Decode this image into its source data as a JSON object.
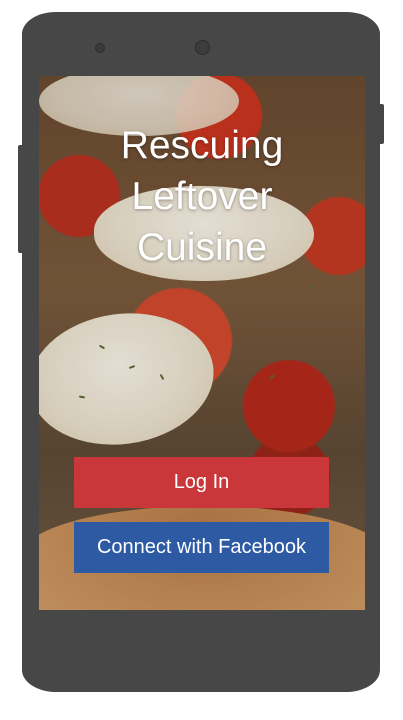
{
  "app": {
    "title_lines": [
      "Rescuing",
      "Leftover",
      "Cuisine"
    ]
  },
  "actions": {
    "login_label": "Log In",
    "facebook_label": "Connect with Facebook"
  },
  "colors": {
    "login_button": "#c9373a",
    "facebook_button": "#2d5aa3",
    "device_frame": "#474747"
  },
  "icons": {
    "speaker": "speaker-icon",
    "camera": "front-camera-icon"
  }
}
